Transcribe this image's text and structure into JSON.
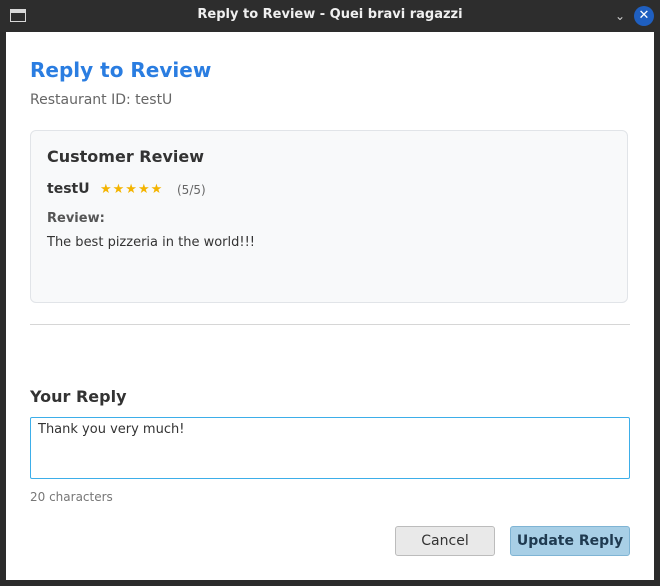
{
  "window": {
    "title": "Reply to Review - Quei bravi ragazzi",
    "minimize_glyph": "⌄",
    "close_glyph": "✕"
  },
  "header": {
    "title": "Reply to Review",
    "subtitle": "Restaurant ID: testU"
  },
  "review_card": {
    "title": "Customer Review",
    "reviewer": "testU",
    "stars": "★★★★★",
    "rating": 5,
    "rating_text": "(5/5)",
    "review_label": "Review:",
    "review_text": "The best pizzeria in the world!!!"
  },
  "reply": {
    "title": "Your Reply",
    "value": "Thank you very much!",
    "char_count": "20 characters"
  },
  "buttons": {
    "cancel_label": "Cancel",
    "update_label": "Update Reply"
  },
  "colors": {
    "accent": "#2a7de1",
    "star": "#f4b400",
    "focus_border": "#3daee9",
    "primary_button": "#a8cfe6",
    "close_button": "#1f5fc0"
  },
  "icons": {
    "app": "window-icon",
    "minimize": "chevron-down-icon",
    "close": "close-icon"
  }
}
